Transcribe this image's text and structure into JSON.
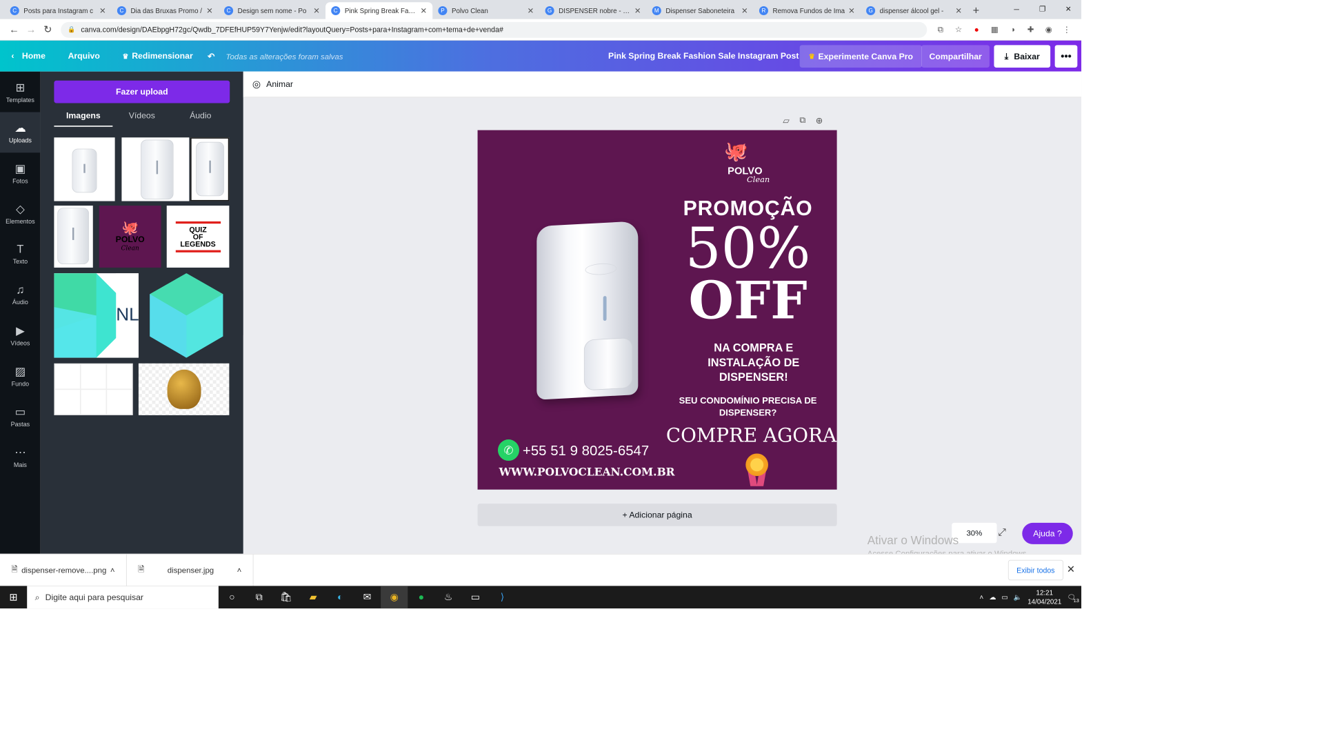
{
  "browser": {
    "tabs": [
      {
        "title": "Posts para Instagram c",
        "favicon": "C"
      },
      {
        "title": "Dia das Bruxas Promo /",
        "favicon": "C"
      },
      {
        "title": "Design sem nome - Po",
        "favicon": "C"
      },
      {
        "title": "Pink Spring Break Fashi",
        "favicon": "C"
      },
      {
        "title": "Polvo Clean",
        "favicon": "P"
      },
      {
        "title": "DISPENSER nobre - Pe",
        "favicon": "G"
      },
      {
        "title": "Dispenser Saboneteira",
        "favicon": "M"
      },
      {
        "title": "Remova Fundos de Ima",
        "favicon": "R"
      },
      {
        "title": "dispenser álcool gel -",
        "favicon": "G"
      }
    ],
    "url": "canva.com/design/DAEbpgH72gc/Qwdb_7DFEfHUP59Y7Yenjw/edit?layoutQuery=Posts+para+Instagram+com+tema+de+venda#"
  },
  "header": {
    "home": "Home",
    "file": "Arquivo",
    "resize": "Redimensionar",
    "saved": "Todas as alterações foram salvas",
    "doc_title": "Pink Spring Break Fashion Sale Instagram Post",
    "pro": "Experimente Canva Pro",
    "share": "Compartilhar",
    "download": "Baixar",
    "more": "•••"
  },
  "rail": [
    {
      "label": "Templates",
      "icon": "templates-icon",
      "glyph": "⊞"
    },
    {
      "label": "Uploads",
      "icon": "upload-cloud-icon",
      "glyph": "☁"
    },
    {
      "label": "Fotos",
      "icon": "photos-icon",
      "glyph": "▣"
    },
    {
      "label": "Elementos",
      "icon": "elements-icon",
      "glyph": "◇"
    },
    {
      "label": "Texto",
      "icon": "text-icon",
      "glyph": "T"
    },
    {
      "label": "Áudio",
      "icon": "audio-icon",
      "glyph": "♫"
    },
    {
      "label": "Vídeos",
      "icon": "video-icon",
      "glyph": "▶"
    },
    {
      "label": "Fundo",
      "icon": "background-icon",
      "glyph": "▨"
    },
    {
      "label": "Pastas",
      "icon": "folder-icon",
      "glyph": "▭"
    },
    {
      "label": "Mais",
      "icon": "more-icon",
      "glyph": "⋯"
    }
  ],
  "panel": {
    "upload": "Fazer upload",
    "tabs": [
      "Imagens",
      "Vídeos",
      "Áudio"
    ],
    "thumb_logo": {
      "line1": "POLVO",
      "line2": "Clean"
    },
    "thumb_quiz": [
      "QUIZ",
      "OF",
      "LEGENDS"
    ],
    "thumb_nl": "NL"
  },
  "toolbar": {
    "animate": "Animar"
  },
  "poster": {
    "logo_main": "POLVO",
    "logo_script": "Clean",
    "promo": "PROMOÇÃO",
    "percent": "50%",
    "off": "OFF",
    "buy_line1": "NA COMPRA E",
    "buy_line2": "INSTALAÇÃO DE",
    "buy_line3": "DISPENSER!",
    "q_line1": "SEU CONDOMÍNIO PRECISA DE",
    "q_line2": "DISPENSER?",
    "cta": "COMPRE AGORA",
    "phone": "+55 51 9 8025-6547",
    "site": "WWW.POLVOCLEAN.COM.BR"
  },
  "canvas": {
    "add_page": "+ Adicionar página",
    "zoom": "30%",
    "help": "Ajuda  ?"
  },
  "watermark": {
    "line1": "Ativar o Windows",
    "line2": "Acesse Configurações para ativar o Windows."
  },
  "downloads": {
    "items": [
      "dispenser-remove....png",
      "dispenser.jpg"
    ],
    "show_all": "Exibir todos"
  },
  "taskbar": {
    "search": "Digite aqui para pesquisar",
    "time": "12:21",
    "date": "14/04/2021",
    "notif": "13"
  },
  "colors": {
    "poster_bg": "#5e1650",
    "accent": "#7d2ae8"
  }
}
